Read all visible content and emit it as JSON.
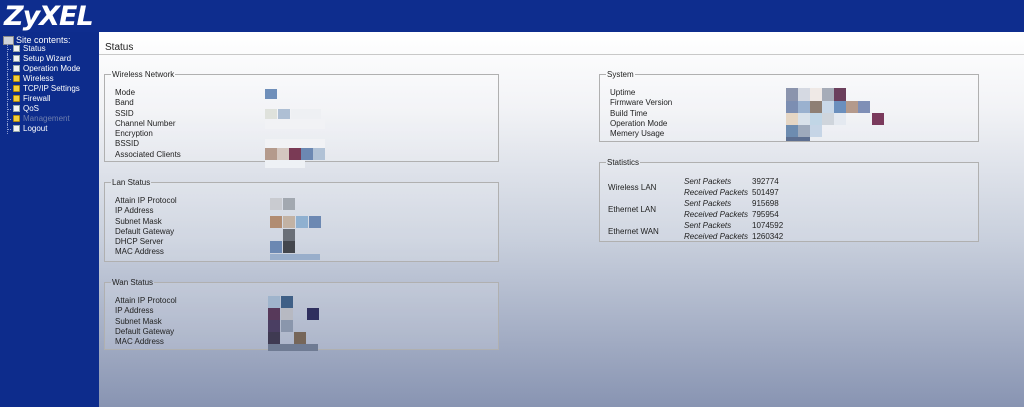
{
  "brand": {
    "logo": "ZyXEL"
  },
  "sidebar": {
    "title": "Site contents:",
    "items": [
      {
        "label": "Status",
        "icon": "doc-icon",
        "disabled": false
      },
      {
        "label": "Setup Wizard",
        "icon": "doc-icon",
        "disabled": false
      },
      {
        "label": "Operation Mode",
        "icon": "doc-icon",
        "disabled": false
      },
      {
        "label": "Wireless",
        "icon": "folder-icon",
        "disabled": false
      },
      {
        "label": "TCP/IP Settings",
        "icon": "folder-icon",
        "disabled": false
      },
      {
        "label": "Firewall",
        "icon": "folder-icon",
        "disabled": false
      },
      {
        "label": "QoS",
        "icon": "doc-icon",
        "disabled": false
      },
      {
        "label": "Management",
        "icon": "folder-icon",
        "disabled": true
      },
      {
        "label": "Logout",
        "icon": "doc-icon",
        "disabled": false
      }
    ]
  },
  "page": {
    "title": "Status"
  },
  "wireless": {
    "legend": "Wireless Network",
    "labels": [
      "Mode",
      "Band",
      "SSID",
      "Channel Number",
      "Encryption",
      "BSSID",
      "Associated Clients"
    ]
  },
  "lan": {
    "legend": "Lan Status",
    "labels": [
      "Attain IP Protocol",
      "IP Address",
      "Subnet Mask",
      "Default Gateway",
      "DHCP Server",
      "MAC Address"
    ]
  },
  "wan": {
    "legend": "Wan Status",
    "labels": [
      "Attain IP Protocol",
      "IP Address",
      "Subnet Mask",
      "Default Gateway",
      "MAC Address"
    ]
  },
  "system": {
    "legend": "System",
    "labels": [
      "Uptime",
      "Firmware Version",
      "Build Time",
      "Operation Mode",
      "Memery Usage"
    ]
  },
  "statistics": {
    "legend": "Statistics",
    "groups": [
      {
        "name": "Wireless LAN",
        "sent_label": "Sent Packets",
        "sent": "392774",
        "recv_label": "Received Packets",
        "recv": "501497"
      },
      {
        "name": "Ethernet LAN",
        "sent_label": "Sent Packets",
        "sent": "915698",
        "recv_label": "Received Packets",
        "recv": "795954"
      },
      {
        "name": "Ethernet WAN",
        "sent_label": "Sent Packets",
        "sent": "1074592",
        "recv_label": "Received Packets",
        "recv": "1260342"
      }
    ]
  }
}
